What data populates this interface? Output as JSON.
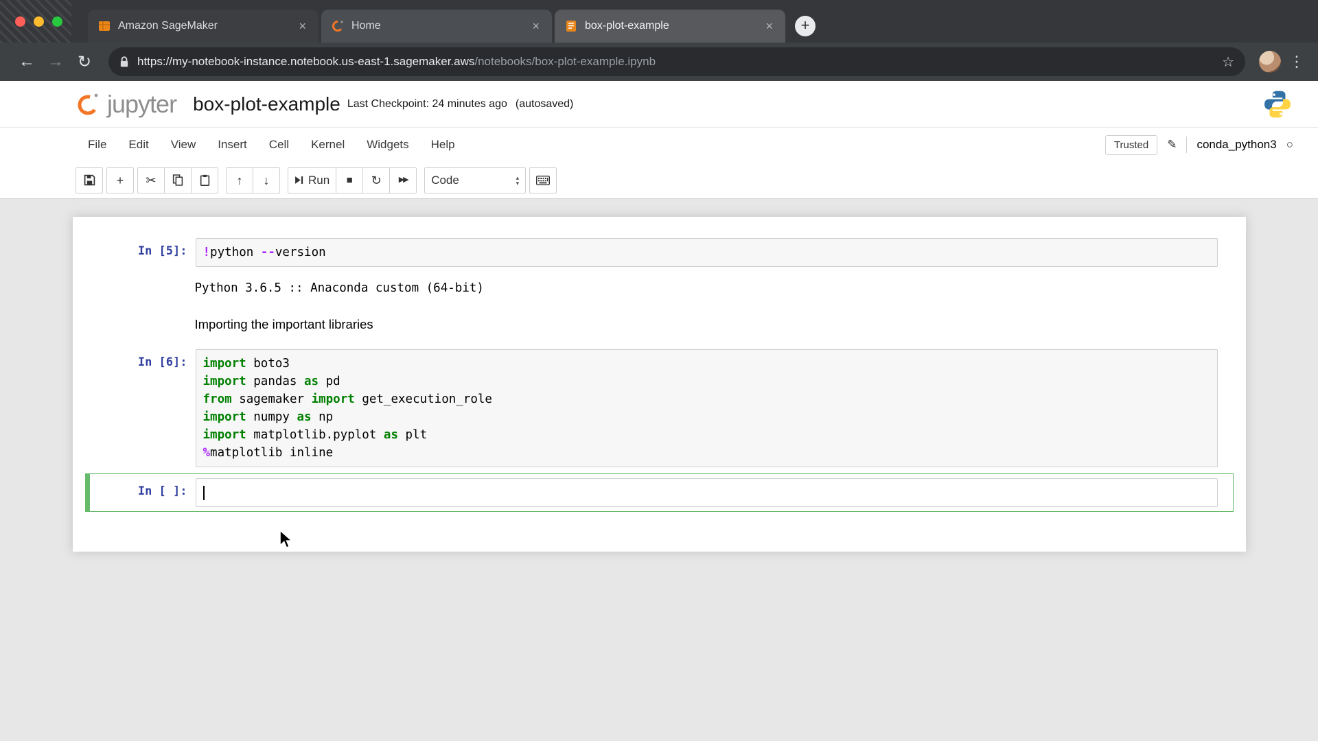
{
  "browser": {
    "tabs": [
      {
        "title": "Amazon SageMaker",
        "close": "×"
      },
      {
        "title": "Home",
        "close": "×"
      },
      {
        "title": "box-plot-example",
        "close": "×"
      }
    ],
    "new_tab": "+",
    "nav": {
      "back": "←",
      "forward": "→",
      "reload": "↻",
      "star": "☆",
      "menu": "⋮"
    },
    "address": {
      "url_main": "https://my-notebook-instance.notebook.us-east-1.sagemaker.aws",
      "url_path": "/notebooks/box-plot-example.ipynb"
    }
  },
  "jupyter": {
    "logo_text": "jupyter",
    "title": "box-plot-example",
    "checkpoint": "Last Checkpoint: 24 minutes ago",
    "autosaved": "(autosaved)",
    "menus": [
      "File",
      "Edit",
      "View",
      "Insert",
      "Cell",
      "Kernel",
      "Widgets",
      "Help"
    ],
    "trusted_label": "Trusted",
    "pencil": "✎",
    "kernel_name": "conda_python3",
    "kernel_indicator": "○",
    "toolbar": {
      "add": "+",
      "cut": "✂",
      "up": "↑",
      "down": "↓",
      "run_label": "Run",
      "stop": "■",
      "restart": "↻",
      "run_all": "▶▶",
      "celltype_value": "Code",
      "arrow_up": "▴",
      "arrow_down": "▾"
    }
  },
  "notebook": {
    "cells": [
      {
        "type": "code",
        "prompt": "In [5]:",
        "lines": [
          [
            {
              "t": "!",
              "c": "op"
            },
            {
              "t": "python ",
              "c": "plain"
            },
            {
              "t": "--",
              "c": "op"
            },
            {
              "t": "version",
              "c": "plain"
            }
          ]
        ],
        "output": "Python 3.6.5 :: Anaconda custom (64-bit)"
      },
      {
        "type": "markdown",
        "text": "Importing the important libraries"
      },
      {
        "type": "code",
        "prompt": "In [6]:",
        "lines": [
          [
            {
              "t": "import",
              "c": "kw"
            },
            {
              "t": " boto3",
              "c": "plain"
            }
          ],
          [
            {
              "t": "import",
              "c": "kw"
            },
            {
              "t": " pandas ",
              "c": "plain"
            },
            {
              "t": "as",
              "c": "kw"
            },
            {
              "t": " pd",
              "c": "plain"
            }
          ],
          [
            {
              "t": "from",
              "c": "kw"
            },
            {
              "t": " sagemaker ",
              "c": "plain"
            },
            {
              "t": "import",
              "c": "kw"
            },
            {
              "t": " get_execution_role",
              "c": "plain"
            }
          ],
          [
            {
              "t": "import",
              "c": "kw"
            },
            {
              "t": " numpy ",
              "c": "plain"
            },
            {
              "t": "as",
              "c": "kw"
            },
            {
              "t": " np",
              "c": "plain"
            }
          ],
          [
            {
              "t": "import",
              "c": "kw"
            },
            {
              "t": " matplotlib.pyplot ",
              "c": "plain"
            },
            {
              "t": "as",
              "c": "kw"
            },
            {
              "t": " plt",
              "c": "plain"
            }
          ],
          [
            {
              "t": "%",
              "c": "op"
            },
            {
              "t": "matplotlib inline",
              "c": "plain"
            }
          ]
        ]
      },
      {
        "type": "code",
        "prompt": "In [ ]:",
        "selected": true
      }
    ]
  },
  "colors": {
    "jupyter_orange": "#F37626",
    "prompt_blue": "#303F9F",
    "keyword_green": "#008000",
    "operator_purple": "#AA22FF",
    "selected_green": "#66BB6A",
    "python_blue": "#3372a7",
    "python_yellow": "#ffd343"
  }
}
